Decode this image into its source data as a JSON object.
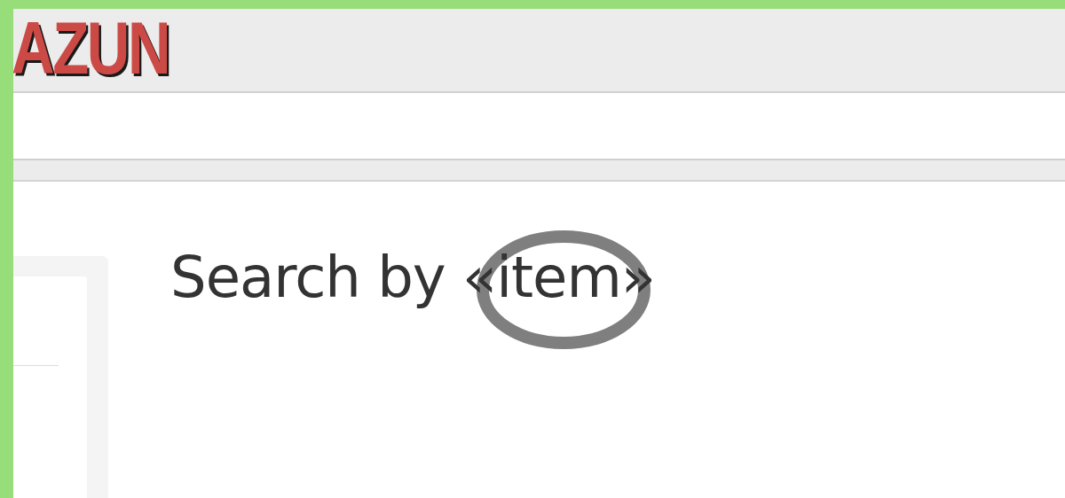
{
  "logo": {
    "text": "AZUN"
  },
  "heading": {
    "text": "Search by «item»"
  }
}
